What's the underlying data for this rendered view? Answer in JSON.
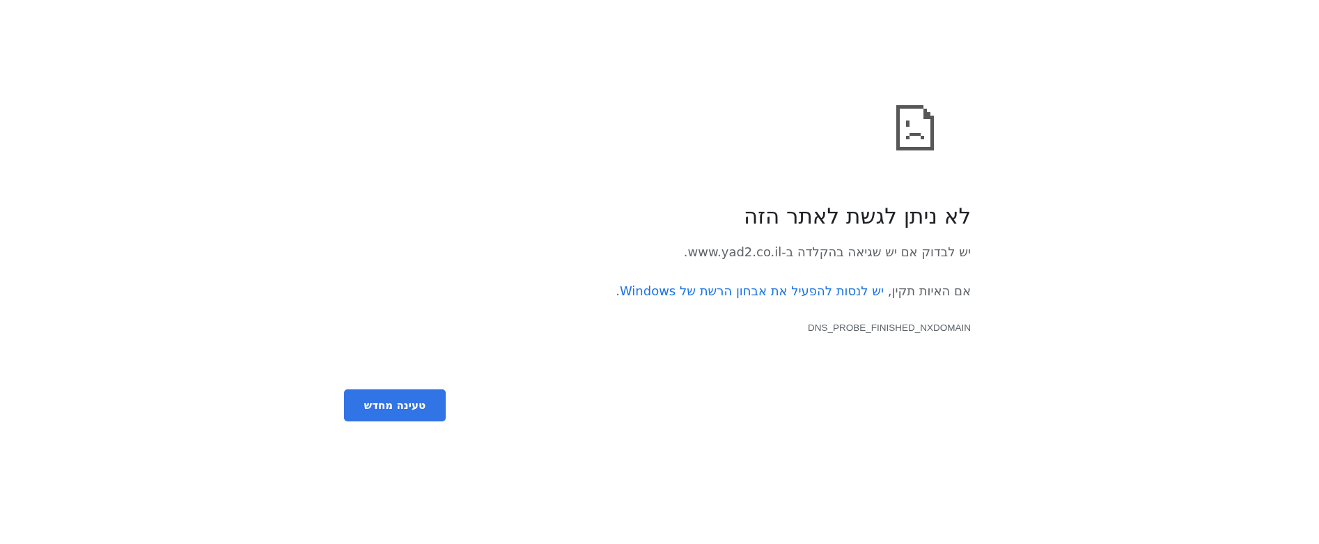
{
  "title": "לא ניתן לגשת לאתר הזה",
  "summary": "יש לבדוק אם יש שגיאה בהקלדה ב-www.yad2.co.il.",
  "suggestion": {
    "prefix": "אם האיות תקין, ",
    "link": "יש לנסות להפעיל את אבחון הרשת של Windows",
    "suffix": "."
  },
  "error_code": "DNS_PROBE_FINISHED_NXDOMAIN",
  "buttons": [
    {
      "label": "טעינה מחדש"
    }
  ]
}
